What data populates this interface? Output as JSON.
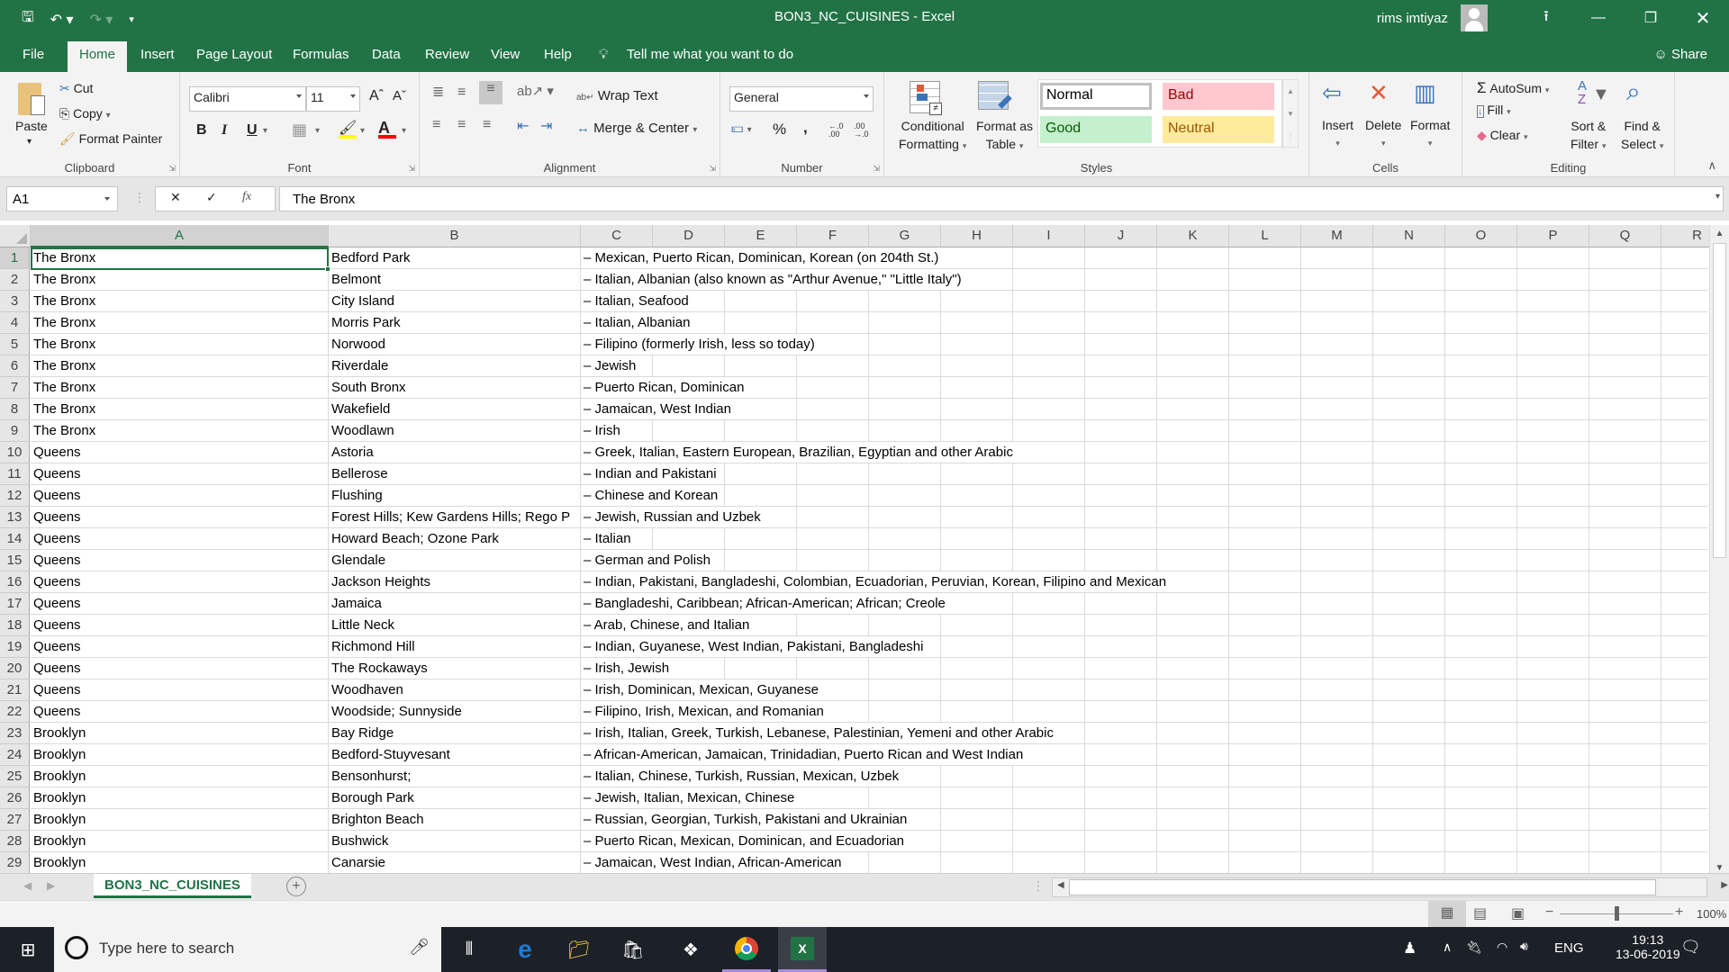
{
  "window": {
    "title": "BON3_NC_CUISINES  -  Excel",
    "user_name": "rims imtiyaz"
  },
  "quick_access": {
    "save_icon": "save-icon",
    "undo_icon": "undo-icon",
    "redo_icon": "redo-icon",
    "customize_icon": "customize-qat-icon"
  },
  "menu_tabs": [
    "File",
    "Home",
    "Insert",
    "Page Layout",
    "Formulas",
    "Data",
    "Review",
    "View",
    "Help"
  ],
  "active_tab": "Home",
  "tell_me": "Tell me what you want to do",
  "share_label": "Share",
  "ribbon": {
    "clipboard": {
      "label": "Clipboard",
      "paste": "Paste",
      "cut": "Cut",
      "copy": "Copy",
      "format_painter": "Format Painter"
    },
    "font": {
      "label": "Font",
      "font_name": "Calibri",
      "font_size": "11",
      "bold": "B",
      "italic": "I",
      "underline": "U",
      "fill_color": "#ffff00",
      "font_color": "#ff0000"
    },
    "alignment": {
      "label": "Alignment",
      "wrap_text": "Wrap Text",
      "merge_center": "Merge & Center"
    },
    "number": {
      "label": "Number",
      "format": "General",
      "percent": "%",
      "comma": ","
    },
    "styles": {
      "label": "Styles",
      "conditional_formatting": [
        "Conditional",
        "Formatting"
      ],
      "format_as_table": [
        "Format as",
        "Table"
      ],
      "normal": "Normal",
      "bad": "Bad",
      "good": "Good",
      "neutral": "Neutral"
    },
    "cells": {
      "label": "Cells",
      "insert": "Insert",
      "delete": "Delete",
      "format": "Format"
    },
    "editing": {
      "label": "Editing",
      "autosum": "AutoSum",
      "fill": "Fill",
      "clear": "Clear",
      "sort_filter": [
        "Sort &",
        "Filter"
      ],
      "find_select": [
        "Find &",
        "Select"
      ]
    }
  },
  "formula_bar": {
    "name_box": "A1",
    "fx": "fx",
    "value": "The Bronx"
  },
  "columns": [
    "A",
    "B",
    "C",
    "D",
    "E",
    "F",
    "G",
    "H",
    "I",
    "J",
    "K",
    "L",
    "M",
    "N",
    "O",
    "P",
    "Q",
    "R"
  ],
  "rows": [
    {
      "n": "1",
      "a": "The Bronx",
      "b": "Bedford Park",
      "c": "– Mexican, Puerto Rican, Dominican, Korean (on 204th St.)"
    },
    {
      "n": "2",
      "a": "The Bronx",
      "b": "Belmont",
      "c": "– Italian, Albanian (also known as \"Arthur Avenue,\" \"Little Italy\")"
    },
    {
      "n": "3",
      "a": "The Bronx",
      "b": "City Island",
      "c": "– Italian, Seafood"
    },
    {
      "n": "4",
      "a": "The Bronx",
      "b": "Morris Park",
      "c": "– Italian, Albanian"
    },
    {
      "n": "5",
      "a": "The Bronx",
      "b": "Norwood",
      "c": "– Filipino (formerly Irish, less so today)"
    },
    {
      "n": "6",
      "a": "The Bronx",
      "b": "Riverdale",
      "c": "– Jewish"
    },
    {
      "n": "7",
      "a": "The Bronx",
      "b": "South Bronx",
      "c": "– Puerto Rican, Dominican"
    },
    {
      "n": "8",
      "a": "The Bronx",
      "b": "Wakefield",
      "c": "– Jamaican, West Indian"
    },
    {
      "n": "9",
      "a": "The Bronx",
      "b": "Woodlawn",
      "c": "– Irish"
    },
    {
      "n": "10",
      "a": "Queens",
      "b": "Astoria",
      "c": "– Greek, Italian, Eastern European, Brazilian, Egyptian and other Arabic"
    },
    {
      "n": "11",
      "a": "Queens",
      "b": "Bellerose",
      "c": "– Indian and Pakistani"
    },
    {
      "n": "12",
      "a": "Queens",
      "b": "Flushing",
      "c": "– Chinese and Korean"
    },
    {
      "n": "13",
      "a": "Queens",
      "b": "Forest Hills; Kew Gardens Hills; Rego P",
      "c": "– Jewish, Russian and Uzbek"
    },
    {
      "n": "14",
      "a": "Queens",
      "b": "Howard Beach; Ozone Park",
      "c": "– Italian"
    },
    {
      "n": "15",
      "a": "Queens",
      "b": "Glendale",
      "c": "– German and Polish"
    },
    {
      "n": "16",
      "a": "Queens",
      "b": "Jackson Heights",
      "c": "– Indian, Pakistani, Bangladeshi, Colombian, Ecuadorian, Peruvian, Korean, Filipino and Mexican"
    },
    {
      "n": "17",
      "a": "Queens",
      "b": "Jamaica",
      "c": "– Bangladeshi, Caribbean; African-American; African; Creole"
    },
    {
      "n": "18",
      "a": "Queens",
      "b": "Little Neck",
      "c": "– Arab, Chinese, and Italian"
    },
    {
      "n": "19",
      "a": "Queens",
      "b": "Richmond Hill",
      "c": "– Indian, Guyanese, West Indian, Pakistani, Bangladeshi"
    },
    {
      "n": "20",
      "a": "Queens",
      "b": "The Rockaways",
      "c": "– Irish, Jewish"
    },
    {
      "n": "21",
      "a": "Queens",
      "b": "Woodhaven",
      "c": "– Irish, Dominican, Mexican, Guyanese"
    },
    {
      "n": "22",
      "a": "Queens",
      "b": "Woodside; Sunnyside",
      "c": "– Filipino, Irish, Mexican, and Romanian"
    },
    {
      "n": "23",
      "a": "Brooklyn",
      "b": "Bay Ridge",
      "c": "– Irish, Italian, Greek, Turkish, Lebanese, Palestinian, Yemeni and other Arabic"
    },
    {
      "n": "24",
      "a": "Brooklyn",
      "b": "Bedford-Stuyvesant",
      "c": "– African-American, Jamaican, Trinidadian, Puerto Rican and West Indian"
    },
    {
      "n": "25",
      "a": "Brooklyn",
      "b": "Bensonhurst;",
      "c": "– Italian, Chinese, Turkish, Russian, Mexican, Uzbek"
    },
    {
      "n": "26",
      "a": "Brooklyn",
      "b": "Borough Park",
      "c": "– Jewish, Italian, Mexican, Chinese"
    },
    {
      "n": "27",
      "a": "Brooklyn",
      "b": "Brighton Beach",
      "c": "– Russian, Georgian, Turkish, Pakistani and Ukrainian"
    },
    {
      "n": "28",
      "a": "Brooklyn",
      "b": "Bushwick",
      "c": "– Puerto Rican, Mexican, Dominican, and Ecuadorian"
    },
    {
      "n": "29",
      "a": "Brooklyn",
      "b": "Canarsie",
      "c": "– Jamaican, West Indian, African-American"
    }
  ],
  "sheet_tab": "BON3_NC_CUISINES",
  "status": {
    "zoom": "100%",
    "zoom_level_percent": 100
  },
  "taskbar": {
    "search_placeholder": "Type here to search",
    "language": "ENG",
    "time": "19:13",
    "date": "13-06-2019"
  },
  "colors": {
    "excel_green": "#217346",
    "bad_bg": "#ffc7ce",
    "bad_fg": "#9c0006",
    "good_bg": "#c6efce",
    "good_fg": "#006100",
    "neutral_bg": "#ffeb9c",
    "neutral_fg": "#9c5700"
  }
}
